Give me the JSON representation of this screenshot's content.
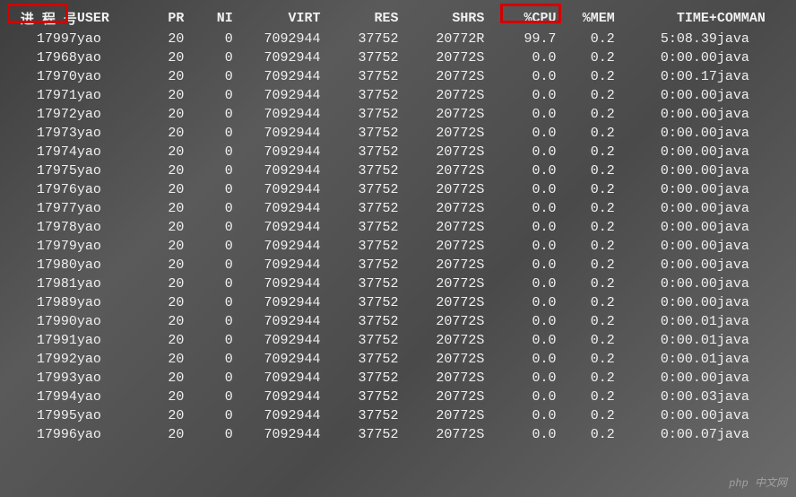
{
  "headers": {
    "pid": "进 程 号",
    "user": "USER",
    "pr": "PR",
    "ni": "NI",
    "virt": "VIRT",
    "res": "RES",
    "shr": "SHR",
    "s": "S",
    "cpu": "%CPU",
    "mem": "%MEM",
    "time": "TIME+",
    "cmd": "COMMAN"
  },
  "rows": [
    {
      "pid": "17997",
      "user": "yao",
      "pr": "20",
      "ni": "0",
      "virt": "7092944",
      "res": "37752",
      "shr": "20772",
      "s": "R",
      "cpu": "99.7",
      "mem": "0.2",
      "time": "5:08.39",
      "cmd": "java"
    },
    {
      "pid": "17968",
      "user": "yao",
      "pr": "20",
      "ni": "0",
      "virt": "7092944",
      "res": "37752",
      "shr": "20772",
      "s": "S",
      "cpu": "0.0",
      "mem": "0.2",
      "time": "0:00.00",
      "cmd": "java"
    },
    {
      "pid": "17970",
      "user": "yao",
      "pr": "20",
      "ni": "0",
      "virt": "7092944",
      "res": "37752",
      "shr": "20772",
      "s": "S",
      "cpu": "0.0",
      "mem": "0.2",
      "time": "0:00.17",
      "cmd": "java"
    },
    {
      "pid": "17971",
      "user": "yao",
      "pr": "20",
      "ni": "0",
      "virt": "7092944",
      "res": "37752",
      "shr": "20772",
      "s": "S",
      "cpu": "0.0",
      "mem": "0.2",
      "time": "0:00.00",
      "cmd": "java"
    },
    {
      "pid": "17972",
      "user": "yao",
      "pr": "20",
      "ni": "0",
      "virt": "7092944",
      "res": "37752",
      "shr": "20772",
      "s": "S",
      "cpu": "0.0",
      "mem": "0.2",
      "time": "0:00.00",
      "cmd": "java"
    },
    {
      "pid": "17973",
      "user": "yao",
      "pr": "20",
      "ni": "0",
      "virt": "7092944",
      "res": "37752",
      "shr": "20772",
      "s": "S",
      "cpu": "0.0",
      "mem": "0.2",
      "time": "0:00.00",
      "cmd": "java"
    },
    {
      "pid": "17974",
      "user": "yao",
      "pr": "20",
      "ni": "0",
      "virt": "7092944",
      "res": "37752",
      "shr": "20772",
      "s": "S",
      "cpu": "0.0",
      "mem": "0.2",
      "time": "0:00.00",
      "cmd": "java"
    },
    {
      "pid": "17975",
      "user": "yao",
      "pr": "20",
      "ni": "0",
      "virt": "7092944",
      "res": "37752",
      "shr": "20772",
      "s": "S",
      "cpu": "0.0",
      "mem": "0.2",
      "time": "0:00.00",
      "cmd": "java"
    },
    {
      "pid": "17976",
      "user": "yao",
      "pr": "20",
      "ni": "0",
      "virt": "7092944",
      "res": "37752",
      "shr": "20772",
      "s": "S",
      "cpu": "0.0",
      "mem": "0.2",
      "time": "0:00.00",
      "cmd": "java"
    },
    {
      "pid": "17977",
      "user": "yao",
      "pr": "20",
      "ni": "0",
      "virt": "7092944",
      "res": "37752",
      "shr": "20772",
      "s": "S",
      "cpu": "0.0",
      "mem": "0.2",
      "time": "0:00.00",
      "cmd": "java"
    },
    {
      "pid": "17978",
      "user": "yao",
      "pr": "20",
      "ni": "0",
      "virt": "7092944",
      "res": "37752",
      "shr": "20772",
      "s": "S",
      "cpu": "0.0",
      "mem": "0.2",
      "time": "0:00.00",
      "cmd": "java"
    },
    {
      "pid": "17979",
      "user": "yao",
      "pr": "20",
      "ni": "0",
      "virt": "7092944",
      "res": "37752",
      "shr": "20772",
      "s": "S",
      "cpu": "0.0",
      "mem": "0.2",
      "time": "0:00.00",
      "cmd": "java"
    },
    {
      "pid": "17980",
      "user": "yao",
      "pr": "20",
      "ni": "0",
      "virt": "7092944",
      "res": "37752",
      "shr": "20772",
      "s": "S",
      "cpu": "0.0",
      "mem": "0.2",
      "time": "0:00.00",
      "cmd": "java"
    },
    {
      "pid": "17981",
      "user": "yao",
      "pr": "20",
      "ni": "0",
      "virt": "7092944",
      "res": "37752",
      "shr": "20772",
      "s": "S",
      "cpu": "0.0",
      "mem": "0.2",
      "time": "0:00.00",
      "cmd": "java"
    },
    {
      "pid": "17989",
      "user": "yao",
      "pr": "20",
      "ni": "0",
      "virt": "7092944",
      "res": "37752",
      "shr": "20772",
      "s": "S",
      "cpu": "0.0",
      "mem": "0.2",
      "time": "0:00.00",
      "cmd": "java"
    },
    {
      "pid": "17990",
      "user": "yao",
      "pr": "20",
      "ni": "0",
      "virt": "7092944",
      "res": "37752",
      "shr": "20772",
      "s": "S",
      "cpu": "0.0",
      "mem": "0.2",
      "time": "0:00.01",
      "cmd": "java"
    },
    {
      "pid": "17991",
      "user": "yao",
      "pr": "20",
      "ni": "0",
      "virt": "7092944",
      "res": "37752",
      "shr": "20772",
      "s": "S",
      "cpu": "0.0",
      "mem": "0.2",
      "time": "0:00.01",
      "cmd": "java"
    },
    {
      "pid": "17992",
      "user": "yao",
      "pr": "20",
      "ni": "0",
      "virt": "7092944",
      "res": "37752",
      "shr": "20772",
      "s": "S",
      "cpu": "0.0",
      "mem": "0.2",
      "time": "0:00.01",
      "cmd": "java"
    },
    {
      "pid": "17993",
      "user": "yao",
      "pr": "20",
      "ni": "0",
      "virt": "7092944",
      "res": "37752",
      "shr": "20772",
      "s": "S",
      "cpu": "0.0",
      "mem": "0.2",
      "time": "0:00.00",
      "cmd": "java"
    },
    {
      "pid": "17994",
      "user": "yao",
      "pr": "20",
      "ni": "0",
      "virt": "7092944",
      "res": "37752",
      "shr": "20772",
      "s": "S",
      "cpu": "0.0",
      "mem": "0.2",
      "time": "0:00.03",
      "cmd": "java"
    },
    {
      "pid": "17995",
      "user": "yao",
      "pr": "20",
      "ni": "0",
      "virt": "7092944",
      "res": "37752",
      "shr": "20772",
      "s": "S",
      "cpu": "0.0",
      "mem": "0.2",
      "time": "0:00.00",
      "cmd": "java"
    },
    {
      "pid": "17996",
      "user": "yao",
      "pr": "20",
      "ni": "0",
      "virt": "7092944",
      "res": "37752",
      "shr": "20772",
      "s": "S",
      "cpu": "0.0",
      "mem": "0.2",
      "time": "0:00.07",
      "cmd": "java"
    }
  ],
  "watermark": "php 中文网"
}
